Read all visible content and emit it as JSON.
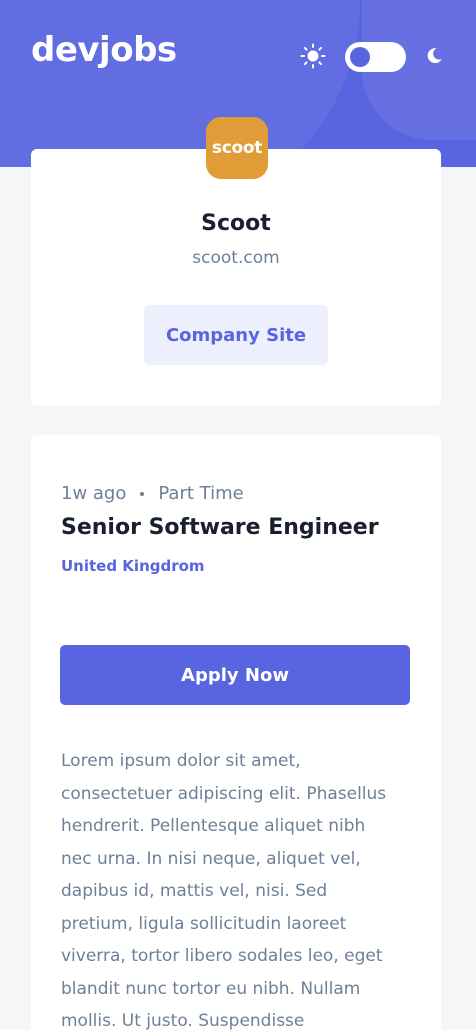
{
  "header": {
    "logo": "devjobs",
    "theme_toggle": {
      "mode": "light",
      "sun_icon": "sun-icon",
      "moon_icon": "moon-icon"
    }
  },
  "company": {
    "logo_text": "scoot",
    "logo_color": "#E09D37",
    "name": "Scoot",
    "website": "scoot.com",
    "site_button_label": "Company Site"
  },
  "job": {
    "posted": "1w ago",
    "contract": "Part Time",
    "title": "Senior Software Engineer",
    "location": "United Kingdrom",
    "apply_label": "Apply Now",
    "description": "Lorem ipsum dolor sit amet, consectetuer adipiscing elit. Phasellus hendrerit. Pellentesque aliquet nibh nec urna. In nisi neque, aliquet vel, dapibus id, mattis vel, nisi. Sed pretium, ligula sollicitudin laoreet viverra, tortor libero sodales leo, eget blandit nunc tortor eu nibh. Nullam mollis. Ut justo. Suspendisse"
  },
  "colors": {
    "accent": "#5964E0",
    "accent_light": "#EEEFFC",
    "text_dark": "#19202D",
    "text_muted": "#6E8098",
    "page_bg": "#F4F6F8"
  }
}
